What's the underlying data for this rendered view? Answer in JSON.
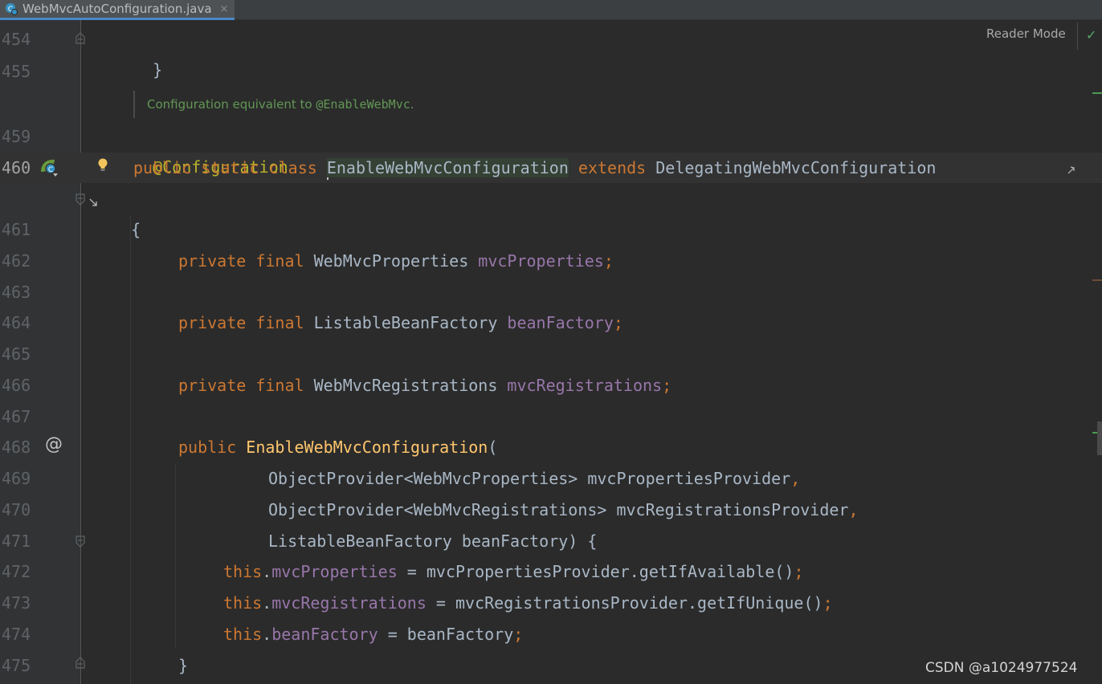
{
  "tab": {
    "label": "WebMvcAutoConfiguration.java",
    "close": "×"
  },
  "toolbar": {
    "reader_mode": "Reader Mode",
    "check": "✓"
  },
  "doc_comment": {
    "text": "Configuration equivalent to ",
    "code": "@EnableWebMvc",
    "end": "."
  },
  "line_numbers": {
    "l454": "454",
    "l455": "455",
    "l459": "459",
    "l460": "460",
    "l461": "461",
    "l462": "462",
    "l463": "463",
    "l464": "464",
    "l465": "465",
    "l466": "466",
    "l467": "467",
    "l468": "468",
    "l469": "469",
    "l470": "470",
    "l471": "471",
    "l472": "472",
    "l473": "473",
    "l474": "474",
    "l475": "475"
  },
  "code": {
    "l454": "}",
    "l459": "@Configuration",
    "l460_kw": "public static class ",
    "l460_cls": "EnableWebMvcConfiguration",
    "l460_ext": " extends ",
    "l460_parent": "DelegatingWebMvcConfiguration",
    "l460b": "{",
    "l462_kw": "private final ",
    "l462_type": "WebMvcProperties ",
    "l462_field": "mvcProperties",
    "l462_semi": ";",
    "l464_kw": "private final ",
    "l464_type": "ListableBeanFactory ",
    "l464_field": "beanFactory",
    "l464_semi": ";",
    "l466_kw": "private final ",
    "l466_type": "WebMvcRegistrations ",
    "l466_field": "mvcRegistrations",
    "l466_semi": ";",
    "l468_kw": "public ",
    "l468_fn": "EnableWebMvcConfiguration",
    "l468_paren": "(",
    "l469_a": "ObjectProvider<WebMvcProperties> mvcPropertiesProvider",
    "l469_comma": ",",
    "l470_a": "ObjectProvider<WebMvcRegistrations> mvcRegistrationsProvider",
    "l470_comma": ",",
    "l471_a": "ListableBeanFactory beanFactory) {",
    "l472_this": "this",
    "l472_dot": ".",
    "l472_field": "mvcProperties",
    "l472_rest": " = mvcPropertiesProvider.getIfAvailable()",
    "l472_semi": ";",
    "l473_this": "this",
    "l473_dot": ".",
    "l473_field": "mvcRegistrations",
    "l473_rest": " = mvcRegistrationsProvider.getIfUnique()",
    "l473_semi": ";",
    "l474_this": "this",
    "l474_dot": ".",
    "l474_field": "beanFactory",
    "l474_rest": " = beanFactory",
    "l474_semi": ";",
    "l475": "}"
  },
  "gutter": {
    "override_marker": "@"
  },
  "watermark": "CSDN @a1024977524",
  "colors": {
    "background": "#2b2b2b",
    "keyword": "#cc7832",
    "annotation": "#bbb529",
    "field": "#9876aa",
    "function": "#ffc66d",
    "text": "#a9b7c6",
    "doc": "#629755"
  }
}
